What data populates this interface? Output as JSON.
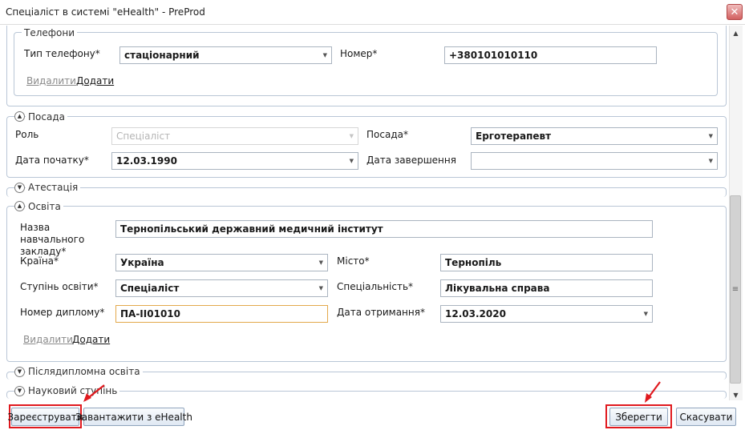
{
  "window": {
    "title": "Спеціаліст в системі \"eHealth\" - PreProd",
    "close_icon": "close-icon"
  },
  "phones": {
    "legend": "Телефони",
    "type_label": "Тип телефону*",
    "type_value": "стаціонарний",
    "number_label": "Номер*",
    "number_value": "+380101010110",
    "delete_link": "Видалити",
    "add_link": "Додати"
  },
  "position": {
    "legend": "Посада",
    "role_label": "Роль",
    "role_value": "Спеціаліст",
    "position_label": "Посада*",
    "position_value": "Ерготерапевт",
    "start_label": "Дата початку*",
    "start_value": "12.03.1990",
    "end_label": "Дата завершення",
    "end_value": ""
  },
  "attestation": {
    "legend": "Атестація"
  },
  "education": {
    "legend": "Освіта",
    "institution_label": "Назва навчального закладу*",
    "institution_value": "Тернопільський державний медичний інститут",
    "country_label": "Країна*",
    "country_value": "Україна",
    "city_label": "Місто*",
    "city_value": "Тернопіль",
    "degree_label": "Ступінь освіти*",
    "degree_value": "Спеціаліст",
    "specialty_label": "Спеціальність*",
    "specialty_value": "Лікувальна справа",
    "diploma_label": "Номер диплому*",
    "diploma_value": "ПА-II01010",
    "received_label": "Дата отримання*",
    "received_value": "12.03.2020",
    "delete_link": "Видалити",
    "add_link": "Додати"
  },
  "postgraduate": {
    "legend": "Післядипломна освіта"
  },
  "science": {
    "legend": "Науковий ступінь"
  },
  "footer": {
    "register_button": "Зареєструвати",
    "load_button": "Завантажити з eHealth",
    "save_button": "Зберегти",
    "cancel_button": "Скасувати"
  },
  "colors": {
    "highlight": "#e0191e",
    "group_border": "#b9c6d6",
    "button_border": "#8fa4bd"
  }
}
